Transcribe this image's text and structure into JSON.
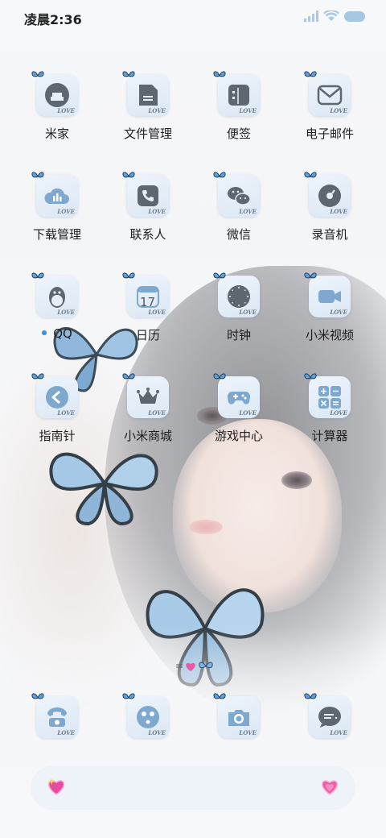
{
  "status_bar": {
    "time": "凌晨2:36"
  },
  "apps": [
    [
      {
        "label": "米家",
        "icon": "mijia-icon"
      },
      {
        "label": "文件管理",
        "icon": "file-manager-icon"
      },
      {
        "label": "便签",
        "icon": "notes-icon"
      },
      {
        "label": "电子邮件",
        "icon": "email-icon"
      }
    ],
    [
      {
        "label": "下载管理",
        "icon": "download-manager-icon"
      },
      {
        "label": "联系人",
        "icon": "contacts-icon"
      },
      {
        "label": "微信",
        "icon": "wechat-icon"
      },
      {
        "label": "录音机",
        "icon": "recorder-icon"
      }
    ],
    [
      {
        "label": "QQ",
        "icon": "qq-icon"
      },
      {
        "label": "日历",
        "icon": "calendar-icon",
        "badge": "17"
      },
      {
        "label": "时钟",
        "icon": "clock-icon"
      },
      {
        "label": "小米视频",
        "icon": "video-icon"
      }
    ],
    [
      {
        "label": "指南针",
        "icon": "compass-icon"
      },
      {
        "label": "小米商城",
        "icon": "mi-store-icon"
      },
      {
        "label": "游戏中心",
        "icon": "game-center-icon"
      },
      {
        "label": "计算器",
        "icon": "calculator-icon"
      }
    ]
  ],
  "icon_tag": "LOVE",
  "dock": [
    {
      "icon": "phone-icon"
    },
    {
      "icon": "browser-icon"
    },
    {
      "icon": "camera-icon"
    },
    {
      "icon": "messages-icon"
    }
  ],
  "colors": {
    "icon_tile": "#dbe8f5",
    "glyph": "#5a6570",
    "accent": "#3a8ee6"
  }
}
